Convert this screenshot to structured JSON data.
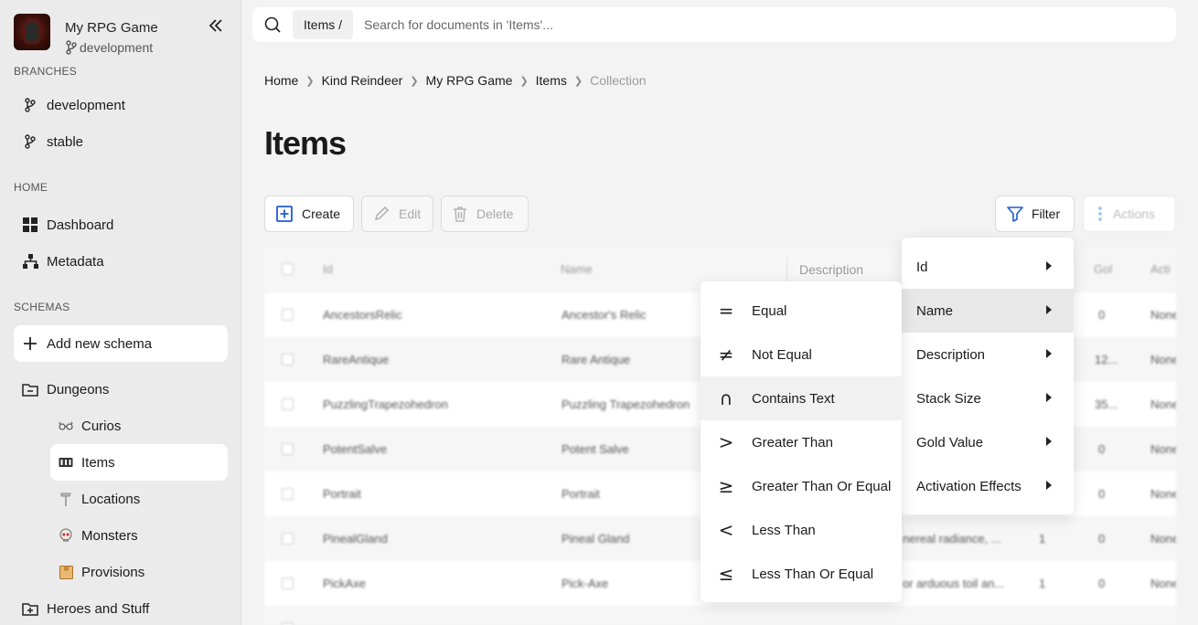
{
  "project": {
    "name": "My RPG Game",
    "branch": "development"
  },
  "sidebar": {
    "branches_label": "BRANCHES",
    "branches": [
      {
        "label": "development"
      },
      {
        "label": "stable"
      }
    ],
    "home_label": "HOME",
    "home_items": [
      {
        "label": "Dashboard"
      },
      {
        "label": "Metadata"
      }
    ],
    "schemas_label": "SCHEMAS",
    "add_schema": "Add new schema",
    "folder": "Dungeons",
    "schemas": [
      {
        "label": "Curios",
        "icon": "glasses-icon"
      },
      {
        "label": "Items",
        "icon": "item-box-icon"
      },
      {
        "label": "Locations",
        "icon": "signpost-icon"
      },
      {
        "label": "Monsters",
        "icon": "skull-icon"
      },
      {
        "label": "Provisions",
        "icon": "crate-icon"
      }
    ],
    "folder2": "Heroes and Stuff"
  },
  "search": {
    "chip": "Items /",
    "placeholder": "Search for documents in 'Items'..."
  },
  "breadcrumb": [
    "Home",
    "Kind Reindeer",
    "My RPG Game",
    "Items",
    "Collection"
  ],
  "page_title": "Items",
  "toolbar": {
    "create": "Create",
    "edit": "Edit",
    "delete": "Delete",
    "filter": "Filter",
    "actions": "Actions"
  },
  "table": {
    "headers": [
      "Id",
      "Name",
      "Description",
      "Gol",
      "Acti"
    ],
    "rows": [
      {
        "id": "AncestorsRelic",
        "name": "Ancestor's Relic",
        "desc": "",
        "stack": "",
        "gold": "0",
        "act": "None"
      },
      {
        "id": "RareAntique",
        "name": "Rare Antique",
        "desc": "",
        "stack": "",
        "gold": "12...",
        "act": "None"
      },
      {
        "id": "PuzzlingTrapezohedron",
        "name": "Puzzling Trapezohedron",
        "desc": "",
        "stack": "",
        "gold": "35...",
        "act": "None"
      },
      {
        "id": "PotentSalve",
        "name": "Potent Salve",
        "desc": "",
        "stack": "",
        "gold": "0",
        "act": "None"
      },
      {
        "id": "Portrait",
        "name": "Portrait",
        "desc": "",
        "stack": "",
        "gold": "0",
        "act": "None"
      },
      {
        "id": "PinealGland",
        "name": "Pineal Gland",
        "desc": "nereal radiance, ...",
        "stack": "1",
        "gold": "0",
        "act": "None"
      },
      {
        "id": "PickAxe",
        "name": "Pick-Axe",
        "desc": "or arduous toil an...",
        "stack": "1",
        "gold": "0",
        "act": "None"
      }
    ]
  },
  "filter_fields": [
    "Id",
    "Name",
    "Description",
    "Stack Size",
    "Gold Value",
    "Activation Effects"
  ],
  "filter_operators": [
    {
      "sym": "=",
      "label": "Equal"
    },
    {
      "sym": "≠",
      "label": "Not Equal"
    },
    {
      "sym": "∩",
      "label": "Contains Text"
    },
    {
      "sym": ">",
      "label": "Greater Than"
    },
    {
      "sym": "≥",
      "label": "Greater Than Or Equal"
    },
    {
      "sym": "<",
      "label": "Less Than"
    },
    {
      "sym": "≤",
      "label": "Less Than Or Equal"
    }
  ]
}
